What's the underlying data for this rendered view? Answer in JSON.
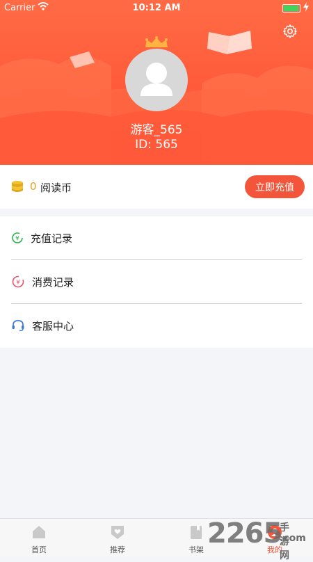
{
  "status_bar": {
    "carrier": "Carrier",
    "time": "10:12 AM"
  },
  "profile": {
    "username": "游客_565",
    "id_text": "ID: 565"
  },
  "coins": {
    "count": "0",
    "label": "阅读币",
    "recharge_label": "立即充值"
  },
  "menu": {
    "items": [
      {
        "label": "充值记录",
        "icon": "recharge-record-icon"
      },
      {
        "label": "消费记录",
        "icon": "consume-record-icon"
      },
      {
        "label": "客服中心",
        "icon": "headset-icon"
      }
    ]
  },
  "tabbar": {
    "tabs": [
      {
        "label": "首页",
        "icon": "home-icon"
      },
      {
        "label": "推荐",
        "icon": "shield-heart-icon"
      },
      {
        "label": "书架",
        "icon": "bookshelf-icon"
      },
      {
        "label": "我的",
        "icon": "profile-icon",
        "active": true
      }
    ]
  },
  "watermark": {
    "main": "2265",
    "top": "手游网",
    "bottom": ".com"
  },
  "colors": {
    "accent": "#f2553a",
    "header": "#ff5a3a",
    "coin": "#e6a11f"
  }
}
